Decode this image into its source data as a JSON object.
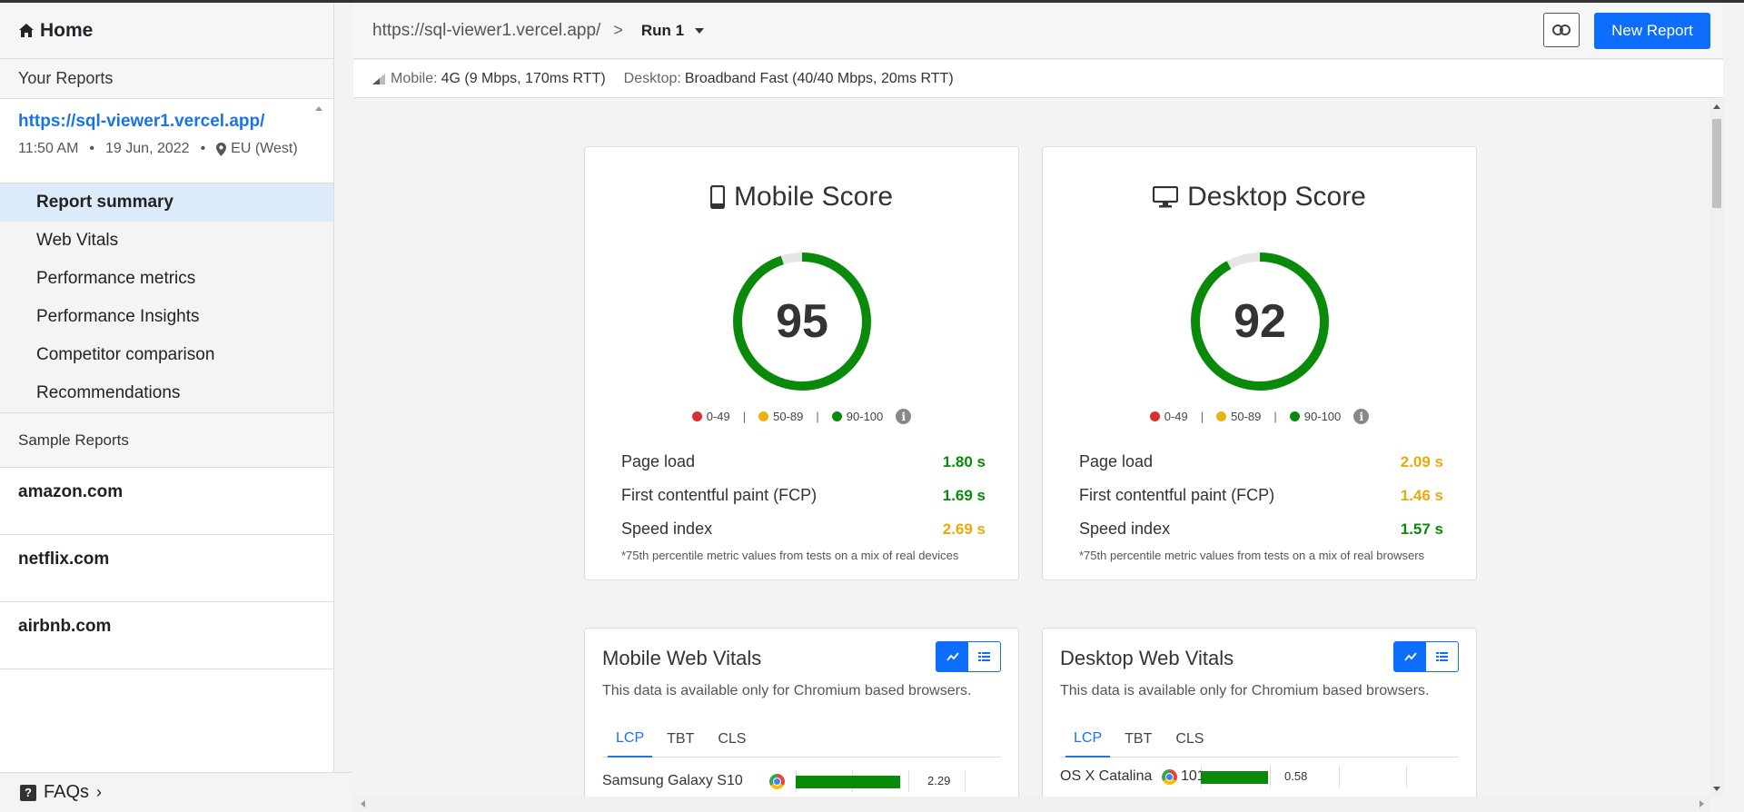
{
  "sidebar": {
    "home_label": "Home",
    "your_reports_label": "Your Reports",
    "report": {
      "url": "https://sql-viewer1.vercel.app/",
      "time": "11:50 AM",
      "date": "19 Jun, 2022",
      "location": "EU (West)"
    },
    "nav": [
      {
        "label": "Report summary",
        "active": true
      },
      {
        "label": "Web Vitals"
      },
      {
        "label": "Performance metrics"
      },
      {
        "label": "Performance Insights"
      },
      {
        "label": "Competitor comparison"
      },
      {
        "label": "Recommendations"
      }
    ],
    "sample_reports_label": "Sample Reports",
    "samples": [
      "amazon.com",
      "netflix.com",
      "airbnb.com"
    ],
    "faq_label": "FAQs"
  },
  "topbar": {
    "url": "https://sql-viewer1.vercel.app/",
    "separator": ">",
    "run_label": "Run 1",
    "new_report_label": "New Report"
  },
  "network": {
    "mobile_label": "Mobile:",
    "mobile_value": "4G (9 Mbps, 170ms RTT)",
    "desktop_label": "Desktop:",
    "desktop_value": "Broadband Fast (40/40 Mbps, 20ms RTT)"
  },
  "legend": {
    "poor": "0-49",
    "average": "50-89",
    "good": "90-100",
    "info": "i",
    "pipe": "|"
  },
  "colors": {
    "good": "#0a8a0a",
    "average": "#e8b30c",
    "poor": "#d43131",
    "accent": "#0d6efd"
  },
  "mobile_score": {
    "title": "Mobile Score",
    "score": 95,
    "score_text": "95",
    "metrics": [
      {
        "label": "Page load",
        "value": "1.80 s",
        "status": "good"
      },
      {
        "label": "First contentful paint (FCP)",
        "value": "1.69 s",
        "status": "good"
      },
      {
        "label": "Speed index",
        "value": "2.69 s",
        "status": "average"
      }
    ],
    "footnote": "*75th percentile metric values from tests on a mix of real devices"
  },
  "desktop_score": {
    "title": "Desktop Score",
    "score": 92,
    "score_text": "92",
    "metrics": [
      {
        "label": "Page load",
        "value": "2.09 s",
        "status": "average"
      },
      {
        "label": "First contentful paint (FCP)",
        "value": "1.46 s",
        "status": "average"
      },
      {
        "label": "Speed index",
        "value": "1.57 s",
        "status": "good"
      }
    ],
    "footnote": "*75th percentile metric values from tests on a mix of real browsers"
  },
  "mobile_web_vitals": {
    "title": "Mobile Web Vitals",
    "subtitle": "This data is available only for Chromium based browsers.",
    "tabs": [
      "LCP",
      "TBT",
      "CLS"
    ],
    "active_tab": "LCP",
    "row": {
      "device": "Samsung Galaxy S10",
      "value": "2.29",
      "fraction": 0.78
    }
  },
  "desktop_web_vitals": {
    "title": "Desktop Web Vitals",
    "subtitle": "This data is available only for Chromium based browsers.",
    "tabs": [
      "LCP",
      "TBT",
      "CLS"
    ],
    "active_tab": "LCP",
    "row": {
      "device": "OS X Catalina",
      "version": "101",
      "value": "0.58",
      "fraction": 0.5
    }
  }
}
